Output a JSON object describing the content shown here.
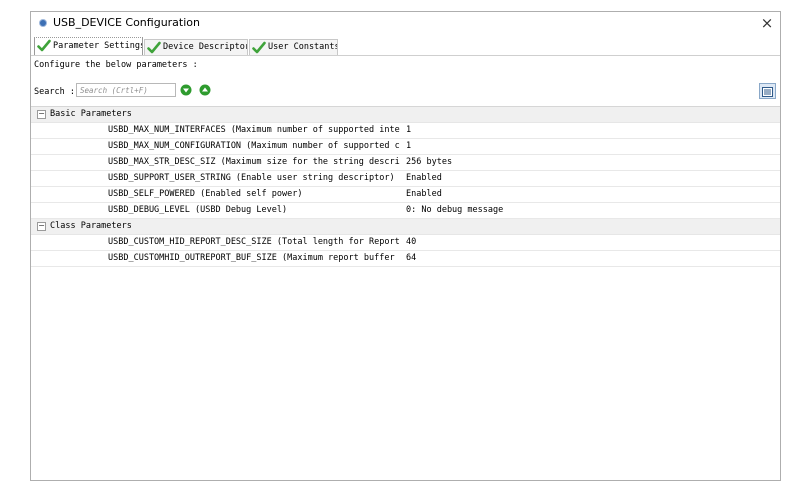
{
  "window": {
    "title": "USB_DEVICE Configuration",
    "close_glyph": "×"
  },
  "tabs": [
    {
      "label": "Parameter Settings",
      "active": true
    },
    {
      "label": "Device Descriptor",
      "active": false
    },
    {
      "label": "User Constants",
      "active": false
    }
  ],
  "prompt": "Configure the below parameters :",
  "search": {
    "label": "Search :",
    "placeholder": "Search (Crtl+F)"
  },
  "icons": {
    "app": "usb-app-icon",
    "tab_check": "green-check-icon",
    "find_next": "green-arrow-down-icon",
    "find_prev": "green-arrow-up-icon",
    "view_toggle": "list-view-icon"
  },
  "colors": {
    "check_green": "#3fa33a",
    "arrow_green": "#2e9b2e",
    "group_bg": "#f0f0f0"
  },
  "groups": [
    {
      "label": "Basic Parameters",
      "toggle": "⊟",
      "rows": [
        {
          "param": "USBD_MAX_NUM_INTERFACES (Maximum number of supported inter...",
          "value": "1"
        },
        {
          "param": "USBD_MAX_NUM_CONFIGURATION (Maximum number of supported co...",
          "value": "1"
        },
        {
          "param": "USBD_MAX_STR_DESC_SIZ (Maximum size for the string descrip...",
          "value": "256 bytes"
        },
        {
          "param": "USBD_SUPPORT_USER_STRING (Enable user string descriptor)",
          "value": "Enabled"
        },
        {
          "param": "USBD_SELF_POWERED (Enabled self power)",
          "value": "Enabled"
        },
        {
          "param": "USBD_DEBUG_LEVEL (USBD Debug Level)",
          "value": "0: No debug message"
        }
      ]
    },
    {
      "label": "Class Parameters",
      "toggle": "⊟",
      "rows": [
        {
          "param": "USBD_CUSTOM_HID_REPORT_DESC_SIZE (Total length for Report ...",
          "value": "40"
        },
        {
          "param": "USBD_CUSTOMHID_OUTREPORT_BUF_SIZE (Maximum report buffer s...",
          "value": "64"
        }
      ]
    }
  ]
}
